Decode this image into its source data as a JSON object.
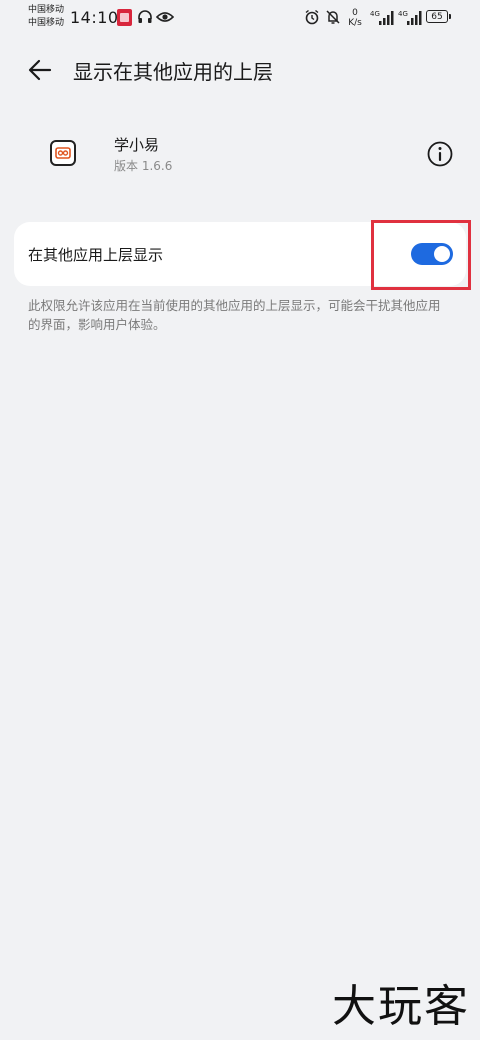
{
  "status_bar": {
    "carrier_1": "中国移动",
    "carrier_2": "中国移动",
    "time": "14:10",
    "net_speed_value": "0",
    "net_speed_unit": "K/s",
    "network_1": "4G",
    "network_2": "4G",
    "battery": "65",
    "icons": [
      "app-notification-icon",
      "headphones-icon",
      "eye-icon",
      "alarm-icon",
      "mute-icon",
      "signal-icon",
      "battery-icon"
    ]
  },
  "header": {
    "back_icon": "arrow-left-icon",
    "title": "显示在其他应用的上层"
  },
  "app": {
    "icon": "app-logo-icon",
    "name": "学小易",
    "version": "版本 1.6.6",
    "info_icon": "info-icon"
  },
  "setting": {
    "label": "在其他应用上层显示",
    "enabled": true
  },
  "description": "此权限允许该应用在当前使用的其他应用的上层显示，可能会干扰其他应用的界面，影响用户体验。",
  "watermark": "大玩客",
  "colors": {
    "background": "#f1f2f4",
    "card": "#ffffff",
    "toggle_on": "#1e6ae0",
    "highlight": "#e0313f",
    "secondary_text": "#7a7a7a"
  }
}
